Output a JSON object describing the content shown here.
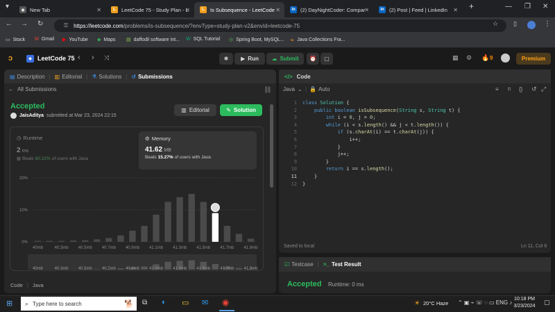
{
  "browser": {
    "tabs": [
      {
        "title": "New Tab",
        "color": "#555"
      },
      {
        "title": "LeetCode 75 - Study Plan - L",
        "color": "#f0a020"
      },
      {
        "title": "Is Subsequence - LeetCode",
        "color": "#f0a020"
      },
      {
        "title": "(2) DayNightCoder: Compar",
        "color": "#0a66c2"
      },
      {
        "title": "(2) Post | Feed | LinkedIn",
        "color": "#0a66c2"
      }
    ],
    "url_domain": "https://leetcode.com",
    "url_path": "/problems/is-subsequence/?envType=study-plan-v2&envId=leetcode-75",
    "bookmarks": [
      "Stock",
      "Gmail",
      "YouTube",
      "Maps",
      "daffodil software Int...",
      "SQL Tutorial",
      "Spring Boot, MySQL...",
      "Java Collections Fra..."
    ]
  },
  "lc": {
    "plan_title": "LeetCode 75",
    "run_label": "Run",
    "submit_label": "Submit",
    "streak": "9",
    "premium": "Premium"
  },
  "left": {
    "tabs": [
      "Description",
      "Editorial",
      "Solutions",
      "Submissions"
    ],
    "back_label": "All Submissions",
    "status": "Accepted",
    "user": "JaisAditya",
    "submitted": "submitted at Mar 23, 2024 22:15",
    "editorial_btn": "Editorial",
    "solution_btn": "Solution",
    "runtime_label": "Runtime",
    "runtime_value": "2",
    "runtime_unit": "ms",
    "runtime_beats_pre": "Beats",
    "runtime_beats_val": "60.22%",
    "runtime_beats_post": "of users with Java",
    "memory_label": "Memory",
    "memory_value": "41.62",
    "memory_unit": "MB",
    "memory_beats_pre": "Beats",
    "memory_beats_val": "15.27%",
    "memory_beats_post": "of users with Java",
    "code_lang_label": "Code",
    "code_lang": "Java"
  },
  "chart_data": {
    "type": "bar",
    "yticks": [
      "20%",
      "10%",
      "0%"
    ],
    "ylim": [
      0,
      20
    ],
    "xticks": [
      "40mb",
      "40.3mb",
      "40.5mb",
      "40.7mb",
      "40.9mb",
      "41.1mb",
      "41.3mb",
      "41.5mb",
      "41.7mb",
      "41.9mb"
    ],
    "values": [
      0.3,
      0.3,
      0.3,
      0.4,
      0.5,
      0.8,
      1.2,
      2.0,
      3.5,
      5.0,
      8.5,
      12.5,
      14.0,
      15.0,
      12.5,
      9.0,
      5.0,
      2.5,
      1.0
    ],
    "highlight_index": 15
  },
  "editor": {
    "title": "Code",
    "lang": "Java",
    "mode": "Auto",
    "lines": [
      "class Solution {",
      "    public boolean isSubsequence(String s, String t) {",
      "        int i = 0, j = 0;",
      "        while (i < s.length() && j < t.length()) {",
      "            if (s.charAt(i) == t.charAt(j)) {",
      "                i++;",
      "            }",
      "            j++;",
      "        }",
      "        return i == s.length();",
      "    }",
      "}"
    ],
    "saved": "Saved to local",
    "cursor": "Ln 11, Col 6"
  },
  "bottom": {
    "testcase": "Testcase",
    "result": "Test Result",
    "accepted": "Accepted",
    "runtime": "Runtime: 0 ms"
  },
  "taskbar": {
    "search_placeholder": "Type here to search",
    "weather": "20°C  Haze",
    "time": "10:18 PM",
    "date": "3/23/2024"
  }
}
